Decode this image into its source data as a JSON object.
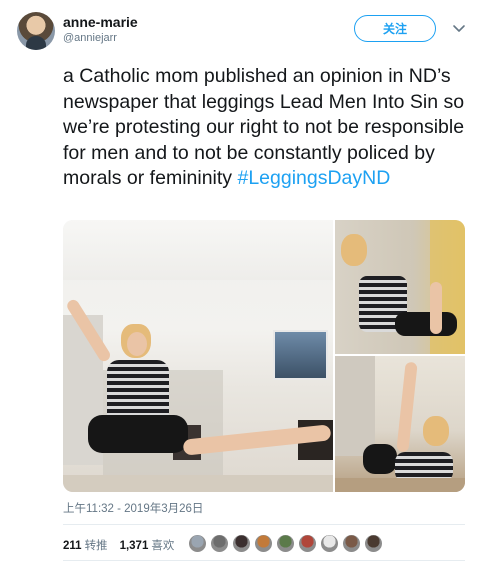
{
  "user": {
    "name": "anne-marie",
    "handle": "@anniejarr"
  },
  "follow_label": "关注",
  "tweet": {
    "text": "a Catholic mom published an opinion in ND’s newspaper that leggings Lead Men Into Sin so we’re protesting our right to not be responsible for men and to not be constantly policed by morals or femininity ",
    "hashtag": "#LeggingsDayND"
  },
  "timestamp": "上午11:32 - 2019年3月26日",
  "stats": {
    "retweets_count": "211",
    "retweets_label": "转推",
    "likes_count": "1,371",
    "likes_label": "喜欢"
  },
  "liker_avatar_colors": [
    "#9aa5b1",
    "#6d6d6d",
    "#3b2f2f",
    "#c27a3a",
    "#5b7a4a",
    "#b0463a",
    "#e8e8e8",
    "#7a5a48",
    "#4a3a30"
  ],
  "colors": {
    "accent": "#1da1f2",
    "text": "#14171a",
    "muted": "#657786"
  },
  "icons": {
    "menu": "chevron-down-icon"
  }
}
